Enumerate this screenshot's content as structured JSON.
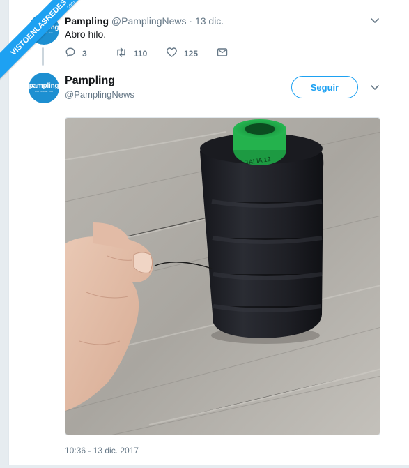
{
  "parent_tweet": {
    "name": "Pampling",
    "handle": "@PamplingNews",
    "separator": "·",
    "date": "13 dic.",
    "text": "Abro hilo.",
    "reply_count": "3",
    "retweet_count": "110",
    "like_count": "125",
    "icons": [
      "reply-icon",
      "retweet-icon",
      "like-icon",
      "direct-message-icon",
      "chevron-down-icon"
    ]
  },
  "main_tweet": {
    "name": "Pampling",
    "handle": "@PamplingNews",
    "follow_label": "Seguir",
    "timestamp": "10:36 - 13 dic. 2017",
    "photo_text": "TALIA 12"
  },
  "avatar": {
    "brand": "pampling",
    "tagline": "crea · diseña · viste"
  },
  "watermark": {
    "text": "VISTOENLASREDES",
    "suffix": ".com"
  },
  "colors": {
    "accent": "#1da1f2",
    "avatar_bg": "#1d8fd1",
    "text": "#14171a",
    "muted": "#657786",
    "spool_core": "#22b24c"
  }
}
